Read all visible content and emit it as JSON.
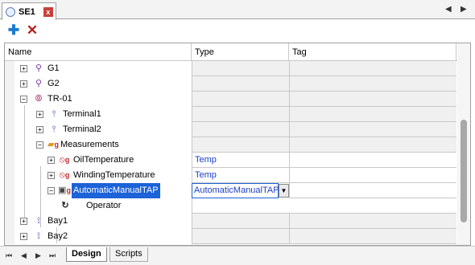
{
  "document_tab": {
    "title": "SE1",
    "close_symbol": "x"
  },
  "toolbar": {
    "add_symbol": "✚",
    "delete_symbol": "✕"
  },
  "columns": [
    "Name",
    "Type",
    "Tag"
  ],
  "tree_rows": [
    {
      "name": "G1",
      "type": "",
      "icon": "generator-icon",
      "expander": "+"
    },
    {
      "name": "G2",
      "type": "",
      "icon": "generator-icon",
      "expander": "+"
    },
    {
      "name": "TR-01",
      "type": "",
      "icon": "transformer-icon",
      "expander": "−"
    },
    {
      "name": "Terminal1",
      "type": "",
      "icon": "terminal-icon",
      "expander": "+"
    },
    {
      "name": "Terminal2",
      "type": "",
      "icon": "terminal-icon",
      "expander": "+"
    },
    {
      "name": "Measurements",
      "type": "",
      "icon": "folder-icon",
      "expander": "−"
    },
    {
      "name": "OilTemperature",
      "type": "Temp",
      "icon": "measurement-icon",
      "expander": "+"
    },
    {
      "name": "WindingTemperature",
      "type": "Temp",
      "icon": "measurement-icon",
      "expander": "+"
    },
    {
      "name": "AutomaticManualTAP",
      "type": "AutomaticManualTAP",
      "icon": "discrete-measurement-icon",
      "expander": "−"
    },
    {
      "name": "Operator",
      "type": "",
      "icon": "operator-icon",
      "expander": ""
    },
    {
      "name": "Bay1",
      "type": "",
      "icon": "bay-icon",
      "expander": "+"
    },
    {
      "name": "Bay2",
      "type": "",
      "icon": "bay-icon",
      "expander": "+"
    }
  ],
  "bottom_tabs": {
    "design": "Design",
    "scripts": "Scripts"
  }
}
